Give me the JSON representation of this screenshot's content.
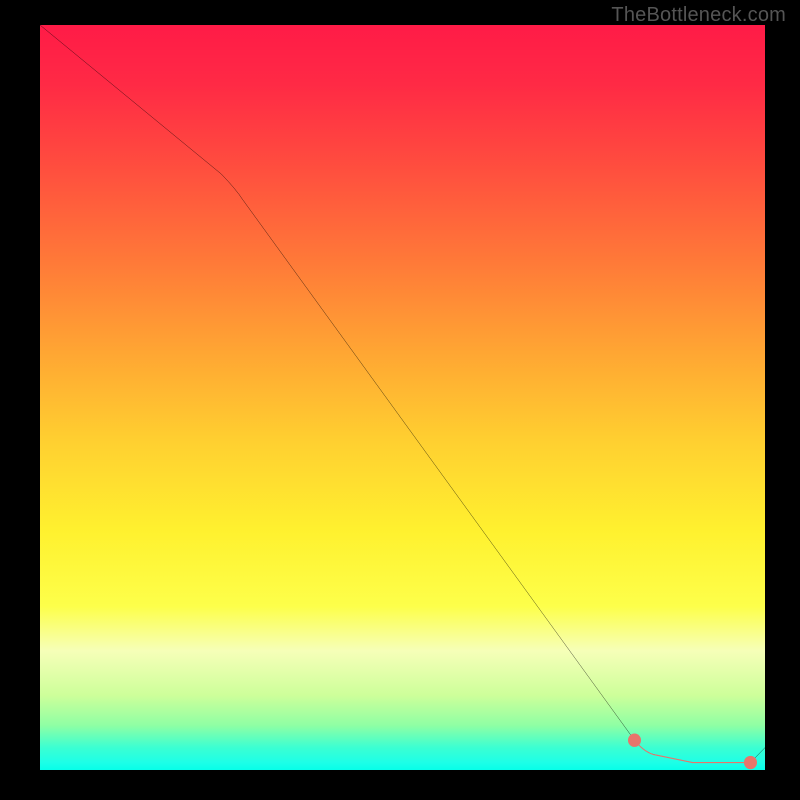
{
  "watermark": "TheBottleneck.com",
  "chart_data": {
    "type": "line",
    "title": "",
    "xlabel": "",
    "ylabel": "",
    "xlim": [
      0,
      100
    ],
    "ylim": [
      0,
      100
    ],
    "series": [
      {
        "name": "curve",
        "x": [
          0,
          25,
          82,
          85,
          90,
          95,
          98,
          100
        ],
        "y": [
          100,
          80,
          4,
          2,
          1,
          1,
          1,
          3
        ]
      }
    ],
    "markers": [
      {
        "name": "range-start",
        "x": 82,
        "y": 4
      },
      {
        "name": "range-end",
        "x": 98,
        "y": 1
      }
    ],
    "highlight_range": {
      "x_start": 82,
      "x_end": 98
    },
    "gradient_stops": [
      {
        "pos": 0.0,
        "color": "#ff1b47"
      },
      {
        "pos": 0.5,
        "color": "#ffd030"
      },
      {
        "pos": 0.8,
        "color": "#fdff4a"
      },
      {
        "pos": 0.95,
        "color": "#3bffd2"
      },
      {
        "pos": 1.0,
        "color": "#06ffe9"
      }
    ]
  }
}
